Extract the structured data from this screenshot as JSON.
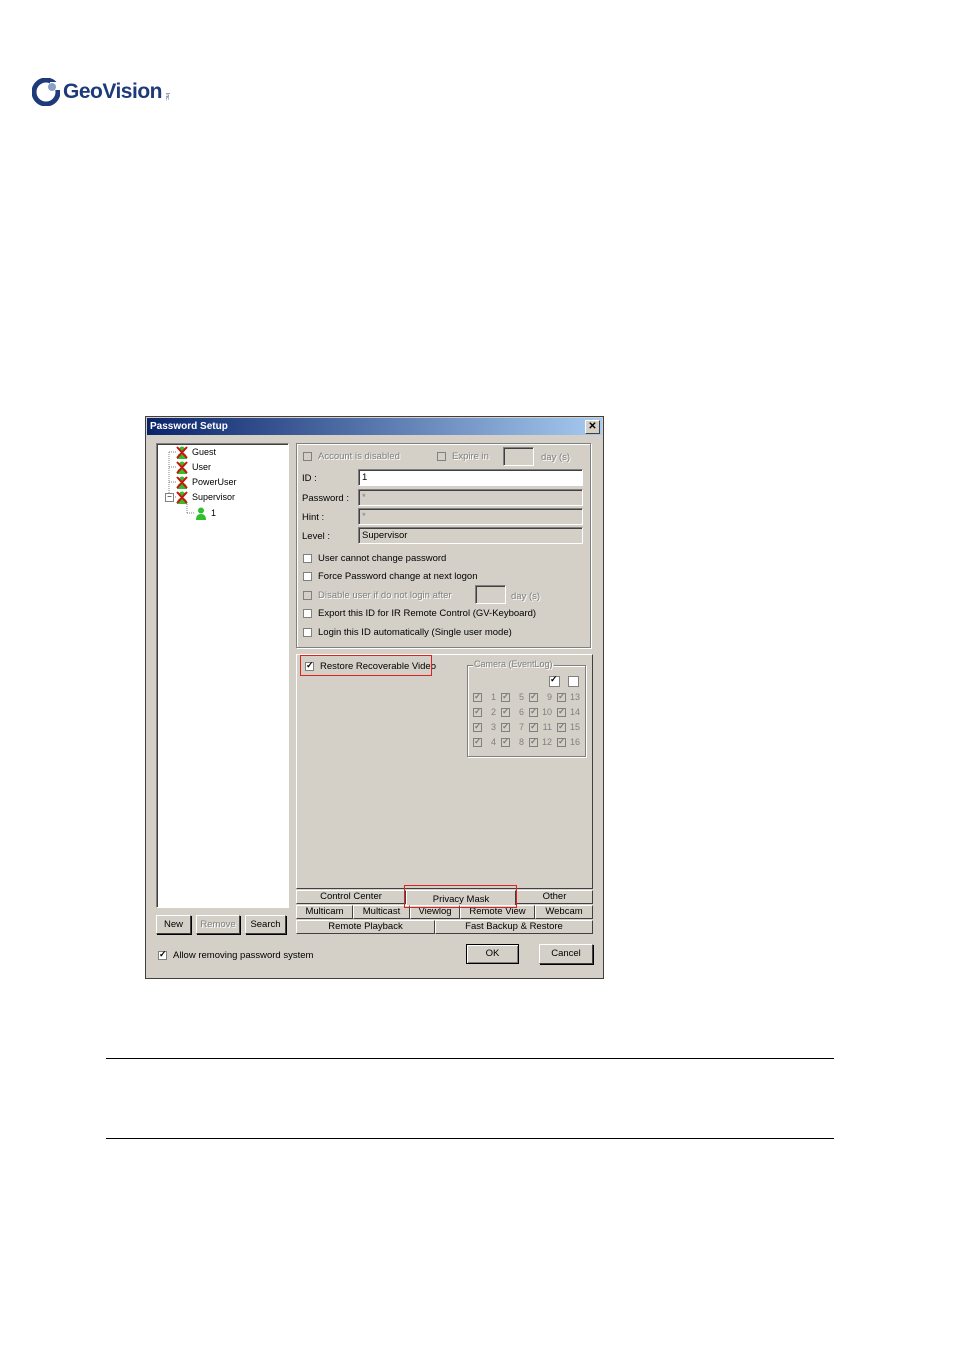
{
  "brand": {
    "name": "GeoVision",
    "tm": "Inc."
  },
  "dialog": {
    "title": "Password Setup",
    "close": "✕",
    "tree": [
      {
        "label": "Guest",
        "icon": "user-disabled-icon"
      },
      {
        "label": "User",
        "icon": "user-disabled-icon"
      },
      {
        "label": "PowerUser",
        "icon": "user-disabled-icon"
      },
      {
        "label": "Supervisor",
        "icon": "user-disabled-icon",
        "expander": "−"
      },
      {
        "label": "1",
        "icon": "user-icon"
      }
    ],
    "left_buttons": {
      "new": "New",
      "remove": "Remove",
      "search": "Search"
    },
    "account": {
      "account_disabled": "Account is disabled",
      "expire_in": "Expire in",
      "expire_days": "",
      "day_unit": "day (s)",
      "id_label": "ID :",
      "id_value": "1",
      "password_label": "Password :",
      "password_value": "*",
      "hint_label": "Hint :",
      "hint_value": "*",
      "level_label": "Level :",
      "level_value": "Supervisor",
      "opt_cannot_change": "User cannot change password",
      "opt_force_change": "Force Password change at next logon",
      "opt_disable_after": "Disable user if do not login after",
      "opt_disable_days": "",
      "opt_day_unit": "day (s)",
      "opt_export": "Export this ID for IR Remote Control (GV-Keyboard)",
      "opt_login_auto": "Login this ID automatically (Single user mode)"
    },
    "privacy": {
      "restore_label": "Restore Recoverable Video",
      "restore_checked": true,
      "camera_group": "Camera (EventLog)",
      "cameras": [
        "1",
        "2",
        "3",
        "4",
        "5",
        "6",
        "7",
        "8",
        "9",
        "10",
        "11",
        "12",
        "13",
        "14",
        "15",
        "16"
      ]
    },
    "tabs_row1": [
      "Control Center",
      "Privacy Mask",
      "Other"
    ],
    "tabs_row2": [
      "Multicam",
      "Multicast",
      "Viewlog",
      "Remote View",
      "Webcam"
    ],
    "tabs_row3": [
      "Remote Playback",
      "Fast Backup & Restore"
    ],
    "allow_removing": "Allow removing password system",
    "allow_removing_checked": true,
    "ok": "OK",
    "cancel": "Cancel"
  },
  "colors": {
    "title_start": "#0a246a",
    "title_end": "#a6caf0",
    "highlight": "#e02020",
    "face": "#d4d0c8"
  }
}
